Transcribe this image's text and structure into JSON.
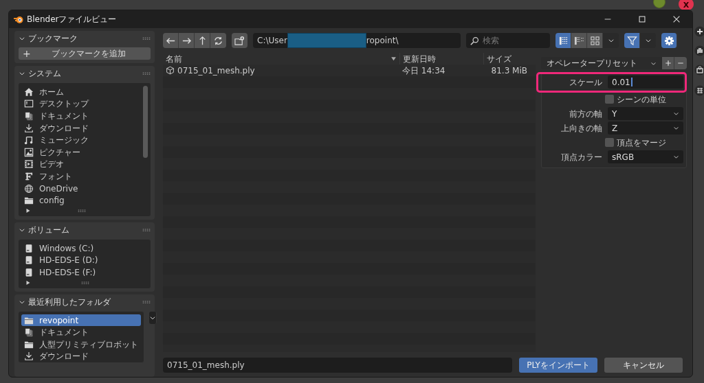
{
  "window": {
    "title": "Blenderファイルビュー"
  },
  "viewport": {
    "axis_label": "X"
  },
  "sidebar": [
    {
      "title": "ブックマーク",
      "expanded": true,
      "kind": "button",
      "button": {
        "icon": "+",
        "label": "ブックマークを追加"
      }
    },
    {
      "title": "システム",
      "expanded": true,
      "kind": "list",
      "items": [
        {
          "label": "ホーム",
          "selected": false
        },
        {
          "label": "デスクトップ",
          "selected": false
        },
        {
          "label": "ドキュメント",
          "selected": false
        },
        {
          "label": "ダウンロード",
          "selected": false
        },
        {
          "label": "ミュージック",
          "selected": false
        },
        {
          "label": "ピクチャー",
          "selected": false
        },
        {
          "label": "ビデオ",
          "selected": false
        },
        {
          "label": "フォント",
          "selected": false
        },
        {
          "label": "OneDrive",
          "selected": false
        },
        {
          "label": "config",
          "selected": false
        }
      ]
    },
    {
      "title": "ボリューム",
      "expanded": true,
      "kind": "list",
      "items": [
        {
          "label": "Windows (C:)",
          "selected": false
        },
        {
          "label": "HD-EDS-E (D:)",
          "selected": false
        },
        {
          "label": "HD-EDS-E (F:)",
          "selected": false
        }
      ]
    },
    {
      "title": "最近利用したフォルダ",
      "expanded": true,
      "kind": "recent",
      "items": [
        {
          "label": "revopoint",
          "selected": true
        },
        {
          "label": "ドキュメント",
          "selected": false
        },
        {
          "label": "人型プリミティブロボット",
          "selected": false
        },
        {
          "label": "ダウンロード",
          "selected": false
        }
      ]
    }
  ],
  "toolbar": {
    "path_start": "C:\\User",
    "path_end": "ropoint\\",
    "search": {
      "placeholder": "検索"
    },
    "display_modes": [
      {
        "selected": true
      },
      {
        "selected": false
      },
      {
        "selected": false
      }
    ],
    "filter": {
      "on": true
    }
  },
  "file_list": {
    "columns": [
      {
        "label": "名前",
        "sorted": true
      },
      {
        "label": "更新日時",
        "sorted": false
      },
      {
        "label": "サイズ",
        "sorted": false
      }
    ],
    "rows": [
      {
        "name": "0715_01_mesh.ply",
        "date": "今日 14:34",
        "size": "81.3 MiB",
        "selected": false
      }
    ]
  },
  "operator": {
    "preset": "オペレータープリセット",
    "properties": [
      {
        "kind": "number",
        "label": "スケール",
        "value": "0.01",
        "editing": true,
        "highlighted": true
      },
      {
        "kind": "checkbox",
        "label": "シーンの単位",
        "checked": false
      },
      {
        "kind": "select",
        "label": "前方の軸",
        "value": "Y"
      },
      {
        "kind": "select",
        "label": "上向きの軸",
        "value": "Z"
      },
      {
        "kind": "checkbox",
        "label": "頂点をマージ",
        "checked": false
      },
      {
        "kind": "select",
        "label": "頂点カラー",
        "value": "sRGB"
      }
    ]
  },
  "footer": {
    "filename": "0715_01_mesh.ply",
    "import_button": "PLYをインポート",
    "cancel_button": "キャンセル"
  }
}
